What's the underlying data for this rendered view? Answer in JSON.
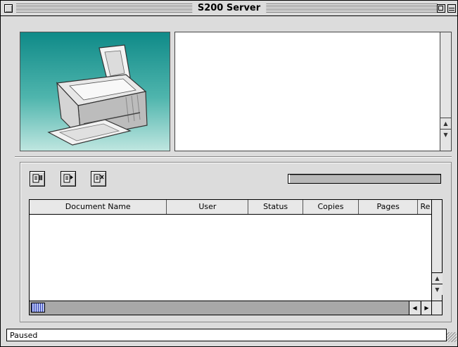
{
  "window": {
    "title": "S200 Server"
  },
  "toolbar": {
    "buttons": [
      {
        "icon": "pause-job-icon"
      },
      {
        "icon": "resume-job-icon"
      },
      {
        "icon": "delete-job-icon"
      }
    ]
  },
  "progress": {
    "value": 0.01
  },
  "table": {
    "columns": [
      "Document Name",
      "User",
      "Status",
      "Copies",
      "Pages",
      "Re"
    ],
    "rows": []
  },
  "status": {
    "text": "Paused"
  },
  "colors": {
    "panel_top": "#0f8a88",
    "panel_bottom": "#bfe6e0",
    "window_bg": "#dcdcdc"
  }
}
